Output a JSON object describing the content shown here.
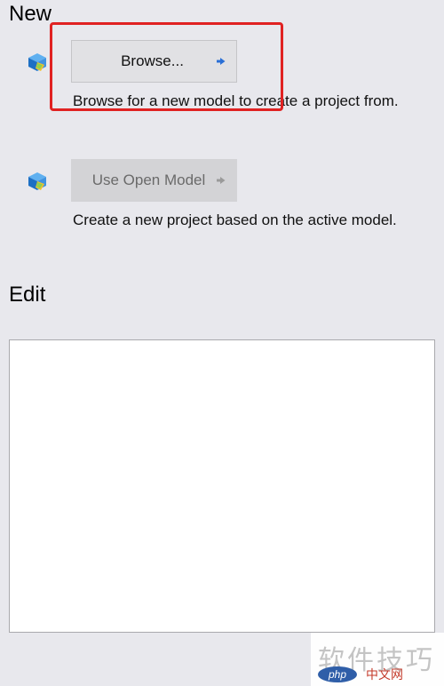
{
  "new_section": {
    "title": "New",
    "browse": {
      "button_label": "Browse...",
      "icon": "model-cube-icon",
      "description": "Browse for a new model to create a project from."
    },
    "use_open_model": {
      "button_label": "Use Open Model",
      "icon": "model-cube-icon",
      "description": "Create a new project based on the active model.",
      "enabled": false
    }
  },
  "edit_section": {
    "title": "Edit"
  },
  "annotation": {
    "highlight_color": "#e02222"
  },
  "watermark": {
    "text": "软件技巧",
    "site": "中文网",
    "logo_text": "php"
  },
  "colors": {
    "background": "#e8e8ed",
    "button_bg": "#e1e1e4",
    "arrow_blue": "#2a6fd6"
  }
}
